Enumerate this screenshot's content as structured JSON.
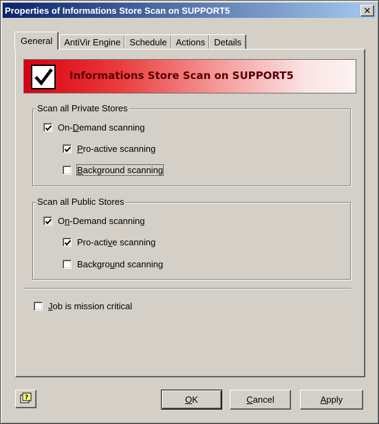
{
  "window": {
    "title": "Properties of Informations Store Scan on SUPPORT5",
    "close_glyph": "✕"
  },
  "tabs": [
    {
      "label": "General",
      "active": true
    },
    {
      "label": "AntiVir Engine",
      "active": false
    },
    {
      "label": "Schedule",
      "active": false
    },
    {
      "label": "Actions",
      "active": false
    },
    {
      "label": "Details",
      "active": false
    }
  ],
  "banner": {
    "title": "Informations Store Scan on SUPPORT5",
    "icon": "checkmark-icon"
  },
  "private_stores": {
    "legend": "Scan all Private Stores",
    "on_demand": {
      "label_pre": "On-",
      "label_ul": "D",
      "label_post": "emand scanning",
      "checked": true
    },
    "proactive": {
      "label_pre": "",
      "label_ul": "P",
      "label_post": "ro-active scanning",
      "checked": true
    },
    "background": {
      "label_pre": "",
      "label_ul": "B",
      "label_post": "ackground scanning",
      "checked": false
    }
  },
  "public_stores": {
    "legend": "Scan all Public Stores",
    "on_demand": {
      "label_pre": "O",
      "label_ul": "n",
      "label_post": "-Demand scanning",
      "checked": true
    },
    "proactive": {
      "label_pre": "Pro-acti",
      "label_ul": "v",
      "label_post": "e scanning",
      "checked": true
    },
    "background": {
      "label_pre": "Backgro",
      "label_ul": "u",
      "label_post": "nd scanning",
      "checked": false
    }
  },
  "mission_critical": {
    "label_pre": "",
    "label_ul": "J",
    "label_post": "ob is mission critical",
    "checked": false
  },
  "buttons": {
    "ok": {
      "label_ul": "O",
      "label_post": "K"
    },
    "cancel": {
      "label_ul": "C",
      "label_post": "ancel"
    },
    "apply": {
      "label_ul": "A",
      "label_post": "pply"
    },
    "help_icon": "help-icon"
  },
  "colors": {
    "title_bar_start": "#0a246a",
    "title_bar_end": "#a6caf0",
    "banner_red": "#d90012",
    "dialog_face": "#d4d0c8"
  }
}
